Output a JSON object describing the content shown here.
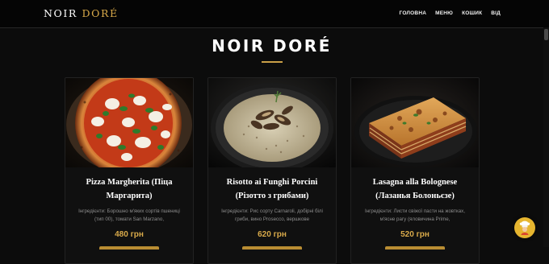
{
  "brand": {
    "name_part1": "NOIR ",
    "name_part2": "DORÉ"
  },
  "nav": {
    "items": [
      "ГОЛОВНА",
      "МЕНЮ",
      "КОШИК",
      "ВІД"
    ]
  },
  "hero": {
    "title": "NOIR DORÉ"
  },
  "dishes": [
    {
      "name": "Pizza Margherita (Піца Маргарита)",
      "ingredients": "Інгредієнти: Борошно м'яких сортів пшениці (тип 00), томати San Marzano,",
      "price": "480 грн",
      "image_icon": "pizza-photo"
    },
    {
      "name": "Risotto ai Funghi Porcini (Різотто з грибами)",
      "ingredients": "Інгредієнти: Рис сорту Carnaroli, добірні білі гриби, вино Prosecco, вершкове",
      "price": "620 грн",
      "image_icon": "risotto-photo"
    },
    {
      "name": "Lasagna alla Bolognese (Лазанья Болоньєзе)",
      "ingredients": "Інгредієнти: Листи свіжої пасти на жовтках, м'ясне рагу (яловичина Prime,",
      "price": "520 грн",
      "image_icon": "lasagna-photo"
    }
  ],
  "floating_button": {
    "icon": "chef-icon"
  },
  "colors": {
    "accent": "#d9aa4a",
    "background": "#0c0c0c",
    "card": "#101010"
  }
}
